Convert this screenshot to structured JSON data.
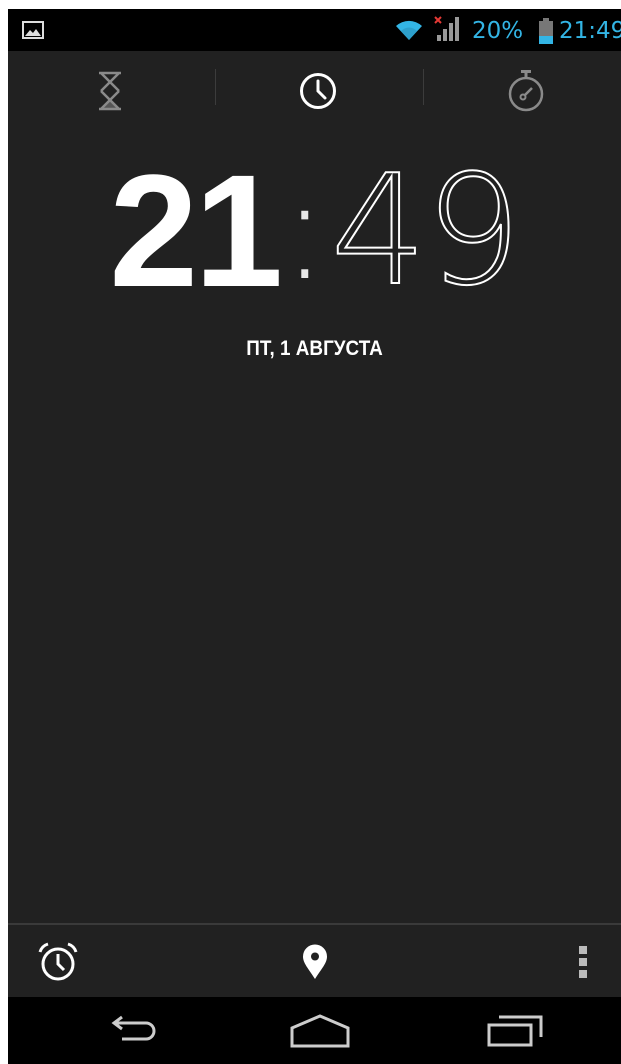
{
  "status_bar": {
    "battery_percent": "20%",
    "time": "21:49",
    "accent_color": "#33b5e5",
    "icons": [
      "gallery-icon",
      "wifi-icon",
      "signal-no-data-icon",
      "battery-icon"
    ]
  },
  "tabs": [
    {
      "name": "timer",
      "icon": "hourglass-icon",
      "selected": false
    },
    {
      "name": "clock",
      "icon": "clock-icon",
      "selected": true
    },
    {
      "name": "stopwatch",
      "icon": "stopwatch-icon",
      "selected": false
    }
  ],
  "clock": {
    "hours": "21",
    "separator": ":",
    "minutes": "49",
    "date": "ПТ, 1 АВГУСТА"
  },
  "action_bar": {
    "icons": [
      "alarm-clock-icon",
      "location-pin-icon",
      "overflow-menu-icon"
    ]
  },
  "nav_bar": {
    "icons": [
      "back-icon",
      "home-icon",
      "recent-apps-icon"
    ]
  }
}
